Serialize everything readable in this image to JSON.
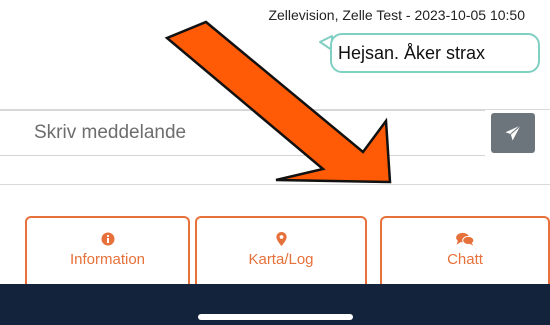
{
  "message": {
    "meta": "Zellevision, Zelle Test - 2023-10-05 10:50",
    "text": "Hejsan. Åker strax"
  },
  "composer": {
    "placeholder": "Skriv meddelande",
    "send_icon": "paper-plane-icon"
  },
  "tabs": [
    {
      "label": "Information",
      "icon": "info-circle-icon"
    },
    {
      "label": "Karta/Log",
      "icon": "map-marker-icon"
    },
    {
      "label": "Chatt",
      "icon": "comments-icon"
    }
  ],
  "colors": {
    "accent": "#e6713b",
    "bubble_border": "#7fcfc3",
    "send_button": "#6c757b",
    "nav_bar": "#13233b",
    "arrow": "#ff5a06"
  }
}
